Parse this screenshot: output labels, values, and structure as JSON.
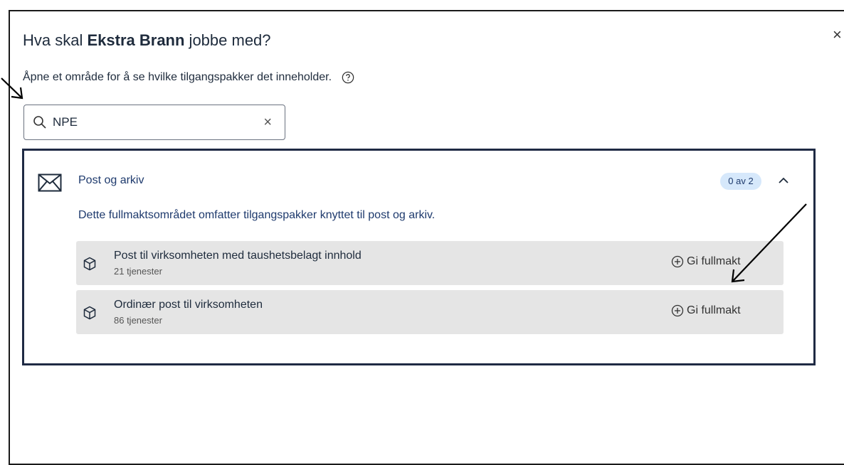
{
  "dialog": {
    "title_prefix": "Hva skal ",
    "title_name": "Ekstra Brann",
    "title_suffix": " jobbe med?",
    "subtitle": "Åpne et område for å se hvilke tilgangspakker det inneholder.",
    "close_icon": "close-icon",
    "help_icon": "question-circle-icon"
  },
  "search": {
    "value": "NPE",
    "clear_label": "×"
  },
  "area": {
    "title": "Post og arkiv",
    "badge": "0 av 2",
    "description": "Dette fullmaktsområdet omfatter tilgangspakker knyttet til post og arkiv.",
    "icon": "envelope-icon",
    "packages": [
      {
        "name": "Post til virksomheten med taushetsbelagt innhold",
        "count": "21 tjenester",
        "action": "Gi fullmakt"
      },
      {
        "name": "Ordinær post til virksomheten",
        "count": "86 tjenester",
        "action": "Gi fullmakt"
      }
    ]
  },
  "colors": {
    "panel_border": "#1f2a44",
    "badge_bg": "#d6e8fb",
    "package_bg": "#e5e5e5",
    "text_blue": "#1e3a6d"
  }
}
